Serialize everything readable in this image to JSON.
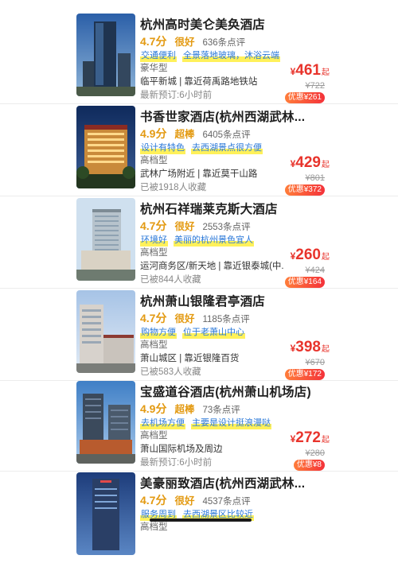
{
  "hotels": [
    {
      "name": "杭州高时美仑美奂酒店",
      "score": "4.7分",
      "score_word": "很好",
      "reviews": "636条点评",
      "tags": [
        "交通便利",
        "全景落地玻璃，沐浴云端"
      ],
      "grade": "豪华型",
      "location": "临平新城 | 靠近荷禹路地铁站",
      "note": "最新预订:6小时前",
      "price_symbol": "¥",
      "price": "461",
      "price_suffix": "起",
      "original_price": "¥722",
      "discount": "优惠¥261"
    },
    {
      "name": "书香世家酒店(杭州西湖武林...",
      "score": "4.9分",
      "score_word": "超棒",
      "reviews": "6405条点评",
      "tags": [
        "设计有特色",
        "去西湖景点很方便"
      ],
      "grade": "高档型",
      "location": "武林广场附近 | 靠近莫干山路",
      "note": "已被1918人收藏",
      "price_symbol": "¥",
      "price": "429",
      "price_suffix": "起",
      "original_price": "¥801",
      "discount": "优惠¥372"
    },
    {
      "name": "杭州石祥瑞莱克斯大酒店",
      "score": "4.7分",
      "score_word": "很好",
      "reviews": "2553条点评",
      "tags": [
        "环境好",
        "美丽的杭州景色宜人"
      ],
      "grade": "高档型",
      "location": "运河商务区/新天地 | 靠近银泰城(中...",
      "note": "已被844人收藏",
      "price_symbol": "¥",
      "price": "260",
      "price_suffix": "起",
      "original_price": "¥424",
      "discount": "优惠¥164"
    },
    {
      "name": "杭州萧山银隆君亭酒店",
      "score": "4.7分",
      "score_word": "很好",
      "reviews": "1185条点评",
      "tags": [
        "购物方便",
        "位于老萧山中心"
      ],
      "grade": "高档型",
      "location": "萧山城区 | 靠近银隆百货",
      "note": "已被583人收藏",
      "price_symbol": "¥",
      "price": "398",
      "price_suffix": "起",
      "original_price": "¥670",
      "discount": "优惠¥172"
    },
    {
      "name": "宝盛道谷酒店(杭州萧山机场店)",
      "score": "4.9分",
      "score_word": "超棒",
      "reviews": "73条点评",
      "tags": [
        "去机场方便",
        "主要是设计挺浪漫哒"
      ],
      "grade": "高档型",
      "location": "萧山国际机场及周边",
      "note": "最新预订:6小时前",
      "price_symbol": "¥",
      "price": "272",
      "price_suffix": "起",
      "original_price": "¥280",
      "discount": "优惠¥8"
    },
    {
      "name": "美豪丽致酒店(杭州西湖武林...",
      "score": "4.7分",
      "score_word": "很好",
      "reviews": "4537条点评",
      "tags": [
        "服务周到",
        "去西湖景区比较近"
      ],
      "grade": "高档型",
      "location": "",
      "note": "",
      "price_symbol": "",
      "price": "",
      "price_suffix": "",
      "original_price": "",
      "discount": ""
    }
  ],
  "colors": {
    "score": "#e39a12",
    "tag_text": "#2a78d8",
    "tag_highlight": "#fff15a",
    "price": "#e8342c",
    "discount_bg": "#f4323a"
  }
}
